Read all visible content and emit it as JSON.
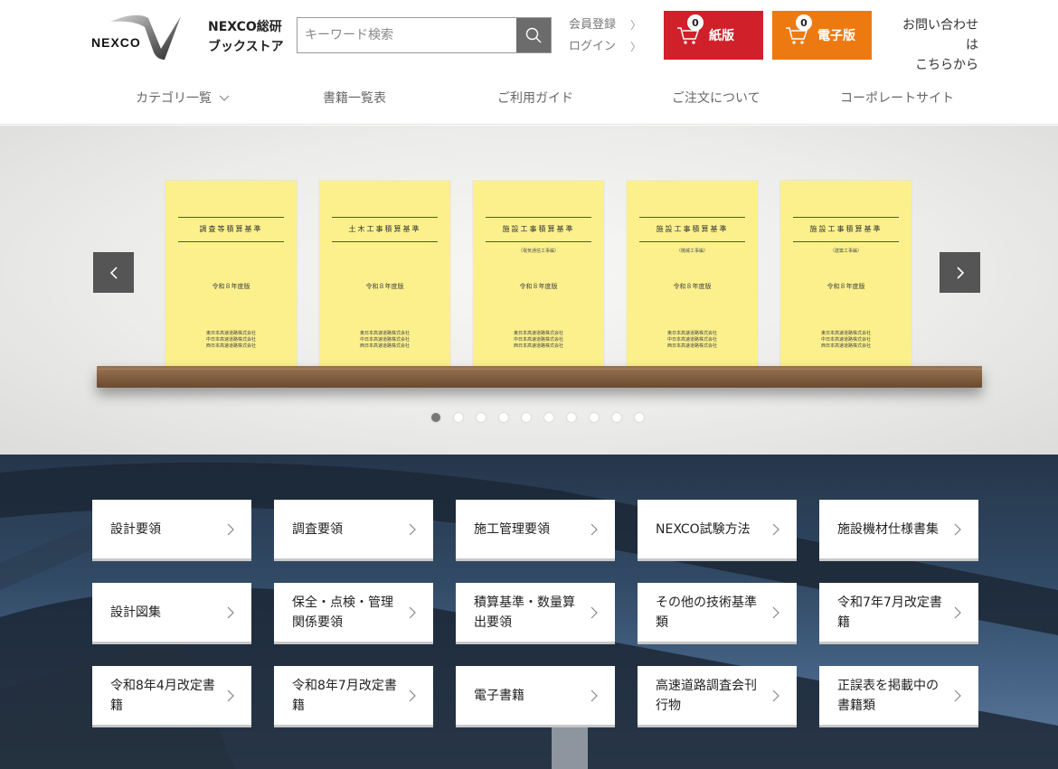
{
  "header": {
    "logo_text": "NEXCO",
    "store_name_line1": "NEXCO総研",
    "store_name_line2": "ブックストア",
    "search_placeholder": "キーワード検索",
    "member_register": "会員登録",
    "login": "ログイン",
    "cart_paper": {
      "label": "紙版",
      "count": "0",
      "color": "#d0202a"
    },
    "cart_ebook": {
      "label": "電子版",
      "count": "0",
      "color": "#ec7a10"
    },
    "contact_line1": "お問い合わせは",
    "contact_line2": "こちらから"
  },
  "nav": [
    {
      "label": "カテゴリ一覧",
      "has_dropdown": true
    },
    {
      "label": "書籍一覧表"
    },
    {
      "label": "ご利用ガイド"
    },
    {
      "label": "ご注文について"
    },
    {
      "label": "コーポレートサイト"
    }
  ],
  "carousel": {
    "books": [
      {
        "title": "調査等積算基準",
        "subtitle": "",
        "edition": "令和８年度版",
        "publishers": [
          "東日本高速道路株式会社",
          "中日本高速道路株式会社",
          "西日本高速道路株式会社"
        ]
      },
      {
        "title": "土木工事積算基準",
        "subtitle": "",
        "edition": "令和８年度版",
        "publishers": [
          "東日本高速道路株式会社",
          "中日本高速道路株式会社",
          "西日本高速道路株式会社"
        ]
      },
      {
        "title": "施設工事積算基準",
        "subtitle": "（電気通信工事編）",
        "edition": "令和８年度版",
        "publishers": [
          "東日本高速道路株式会社",
          "中日本高速道路株式会社",
          "西日本高速道路株式会社"
        ]
      },
      {
        "title": "施設工事積算基準",
        "subtitle": "（機械工事編）",
        "edition": "令和８年度版",
        "publishers": [
          "東日本高速道路株式会社",
          "中日本高速道路株式会社",
          "西日本高速道路株式会社"
        ]
      },
      {
        "title": "施設工事積算基準",
        "subtitle": "（建築工事編）",
        "edition": "令和８年度版",
        "publishers": [
          "東日本高速道路株式会社",
          "中日本高速道路株式会社",
          "西日本高速道路株式会社"
        ]
      }
    ],
    "slide_count": 10,
    "active_slide": 0
  },
  "categories": [
    "設計要領",
    "調査要領",
    "施工管理要領",
    "NEXCO試験方法",
    "施設機材仕様書集",
    "設計図集",
    "保全・点検・管理関係要領",
    "積算基準・数量算出要領",
    "その他の技術基準類",
    "令和7年7月改定書籍",
    "令和8年4月改定書籍",
    "令和8年7月改定書籍",
    "電子書籍",
    "高速道路調査会刊行物",
    "正誤表を掲載中の書籍類"
  ]
}
